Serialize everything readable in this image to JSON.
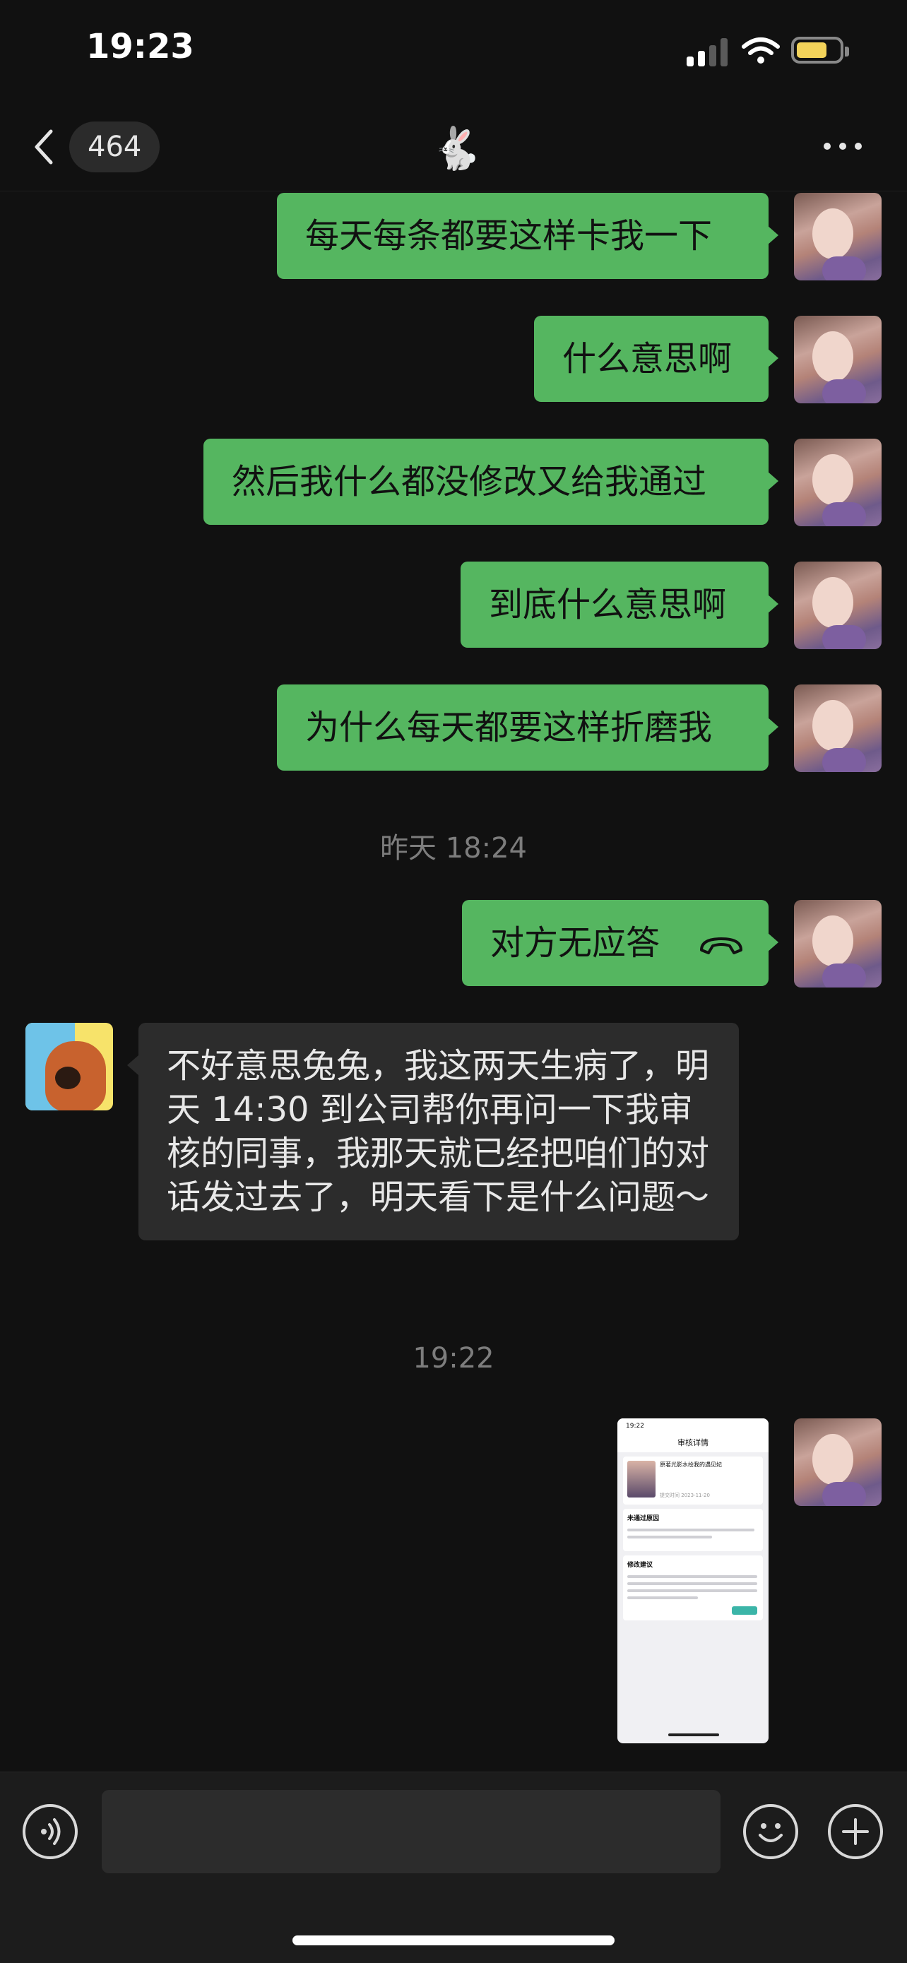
{
  "status_bar": {
    "time": "19:23",
    "battery_color": "#f3d35a"
  },
  "nav": {
    "unread_count": "464",
    "title_icon": "rabbit-emoji",
    "title_glyph": "🐇"
  },
  "messages": [
    {
      "side": "out",
      "text": "每天每条都要这样卡我一下"
    },
    {
      "side": "out",
      "text": "什么意思啊"
    },
    {
      "side": "out",
      "text": "然后我什么都没修改又给我通过"
    },
    {
      "side": "out",
      "text": "到底什么意思啊"
    },
    {
      "side": "out",
      "text": "为什么每天都要这样折磨我"
    },
    {
      "type": "timestamp",
      "text": "昨天 18:24"
    },
    {
      "side": "out",
      "type": "call",
      "text": "对方无应答"
    },
    {
      "side": "in",
      "text": "不好意思兔兔，我这两天生病了，明天 14:30 到公司帮你再问一下我审核的同事，我那天就已经把咱们的对话发过去了，明天看下是什么问题～"
    },
    {
      "type": "timestamp",
      "text": "19:22"
    },
    {
      "side": "out",
      "type": "image",
      "image": {
        "status_time": "19:22",
        "screen_title": "审核详情",
        "item_title": "原著光影水绘我的遇见妃",
        "item_meta": "提交时间 2023-11-20",
        "section1": "未通过原因",
        "section2": "修改建议"
      }
    }
  ],
  "input": {
    "placeholder": ""
  },
  "colors": {
    "outgoing_bubble": "#55b660",
    "incoming_bubble": "#2c2c2c",
    "background": "#111111"
  }
}
